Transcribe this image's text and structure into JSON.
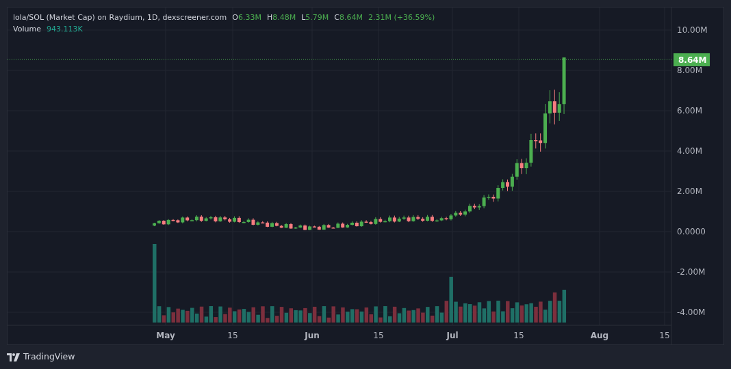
{
  "legend": {
    "title": "lola/SOL (Market Cap) on Raydium, 1D, dexscreener.com",
    "ohlc": [
      {
        "label": "O",
        "value": "6.33M"
      },
      {
        "label": "H",
        "value": "8.48M"
      },
      {
        "label": "L",
        "value": "5.79M"
      },
      {
        "label": "C",
        "value": "8.64M"
      }
    ],
    "change": "2.31M (+36.59%)",
    "volume": {
      "label": "Volume",
      "value": "943.113K"
    }
  },
  "price_axis": {
    "ticks": [
      "10.00M",
      "8.00M",
      "6.00M",
      "4.00M",
      "2.00M",
      "0.0000",
      "-2.00M",
      "-4.00M"
    ],
    "last_price": "8.64M"
  },
  "time_axis": {
    "ticks": [
      "May",
      "15",
      "Jun",
      "15",
      "Jul",
      "15",
      "Aug",
      "15"
    ]
  },
  "footer": {
    "brand": "TradingView"
  }
}
